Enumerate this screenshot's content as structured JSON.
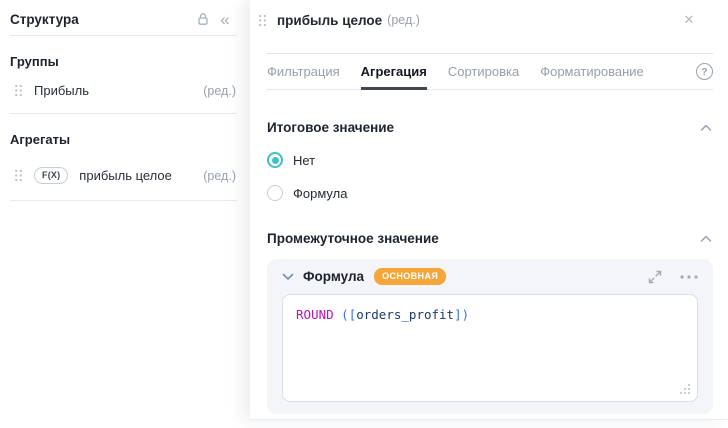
{
  "colors": {
    "accent_teal": "#3fc0c7",
    "badge_orange": "#f5a63a",
    "code_function": "#b414bc",
    "code_bracket": "#3a72d9",
    "code_field": "#1c3a66",
    "tab_active_underline": "#42464d"
  },
  "icons": {
    "close": "✕",
    "collapse_sidebar": "«",
    "help": "?"
  },
  "sidebar": {
    "title": "Структура",
    "groups": {
      "label": "Группы",
      "item": {
        "name": "Прибыль",
        "edit": "(ред.)"
      }
    },
    "aggregates": {
      "label": "Агрегаты",
      "item": {
        "badge": "F(X)",
        "name": "прибыль целое",
        "edit": "(ред.)"
      }
    }
  },
  "panel": {
    "title": "прибыль целое",
    "title_edit": "(ред.)",
    "tabs": [
      {
        "label": "Фильтрация",
        "active": false
      },
      {
        "label": "Агрегация",
        "active": true
      },
      {
        "label": "Сортировка",
        "active": false
      },
      {
        "label": "Форматирование",
        "active": false
      }
    ],
    "total_section": {
      "title": "Итоговое значение",
      "options": [
        {
          "label": "Нет",
          "selected": true
        },
        {
          "label": "Формула",
          "selected": false
        }
      ]
    },
    "intermediate_section": {
      "title": "Промежуточное значение",
      "formula_block": {
        "label": "Формула",
        "badge": "ОСНОВНАЯ",
        "code_tokens": [
          {
            "text": "ROUND",
            "type": "function"
          },
          {
            "text": " (",
            "type": "bracket"
          },
          {
            "text": "[",
            "type": "bracket"
          },
          {
            "text": "orders_profit",
            "type": "field"
          },
          {
            "text": "]",
            "type": "bracket"
          },
          {
            "text": ")",
            "type": "bracket"
          }
        ]
      }
    }
  }
}
